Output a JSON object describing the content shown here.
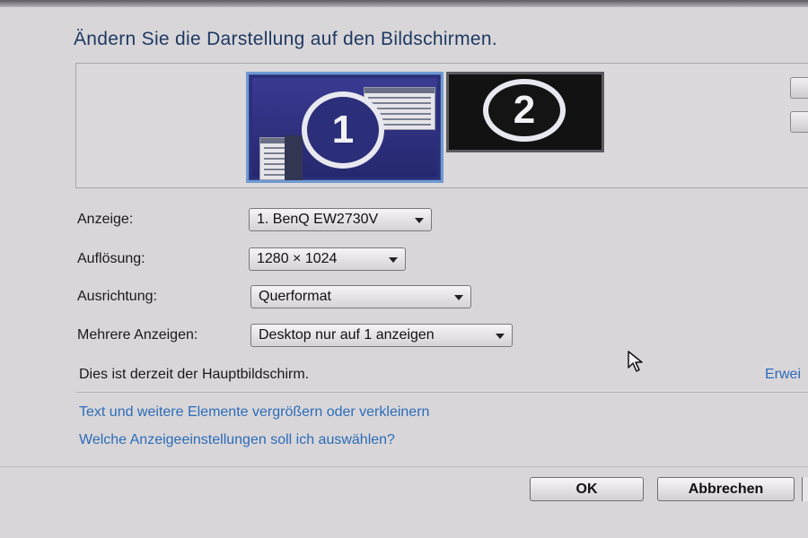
{
  "window": {
    "heading": "Ändern Sie die Darstellung auf den Bildschirmen."
  },
  "monitors": [
    {
      "number": "1",
      "selected": true
    },
    {
      "number": "2",
      "selected": false
    }
  ],
  "settings": {
    "display": {
      "label": "Anzeige:",
      "value": "1. BenQ EW2730V"
    },
    "resolution": {
      "label": "Auflösung:",
      "value": "1280 × 1024"
    },
    "orientation": {
      "label": "Ausrichtung:",
      "value": "Querformat"
    },
    "multiple": {
      "label": "Mehrere Anzeigen:",
      "value": "Desktop nur auf 1 anzeigen"
    }
  },
  "status": {
    "main_display_text": "Dies ist derzeit der Hauptbildschirm.",
    "advanced_link": "Erwei"
  },
  "links": {
    "text_size": "Text und weitere Elemente vergrößern oder verkleinern",
    "which_settings": "Welche Anzeigeeinstellungen soll ich auswählen?"
  },
  "buttons": {
    "ok": "OK",
    "cancel": "Abbrechen"
  },
  "colors": {
    "link": "#2b6cb8",
    "selected_monitor_border": "#6f9ad2",
    "heading": "#1e3a63"
  }
}
